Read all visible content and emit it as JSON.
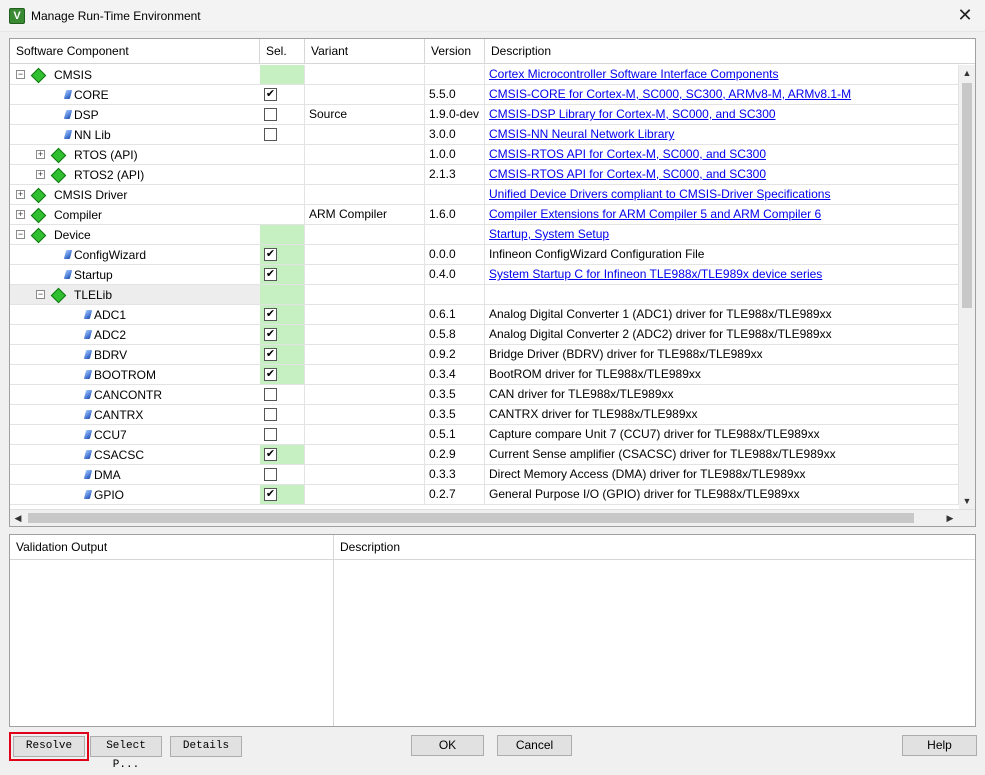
{
  "window": {
    "title": "Manage Run-Time Environment",
    "app_icon": "V"
  },
  "columns": {
    "component": "Software Component",
    "sel": "Sel.",
    "variant": "Variant",
    "version": "Version",
    "description": "Description"
  },
  "rows": [
    {
      "name": "CMSIS",
      "level": 0,
      "expander": "minus",
      "icon": "diamond-icon",
      "sel_green": true,
      "checked": null,
      "variant": "",
      "version": "",
      "desc": "Cortex Microcontroller Software Interface Components",
      "link": true
    },
    {
      "name": "CORE",
      "level": 1,
      "expander": "",
      "icon": "gem-icon",
      "sel_green": false,
      "checked": true,
      "variant": "",
      "version": "5.5.0",
      "desc": "CMSIS-CORE for Cortex-M, SC000, SC300, ARMv8-M, ARMv8.1-M",
      "link": true
    },
    {
      "name": "DSP",
      "level": 1,
      "expander": "",
      "icon": "gem-icon",
      "sel_green": false,
      "checked": false,
      "variant": "Source",
      "version": "1.9.0-dev",
      "desc": "CMSIS-DSP Library for Cortex-M, SC000, and SC300",
      "link": true
    },
    {
      "name": "NN Lib",
      "level": 1,
      "expander": "",
      "icon": "gem-icon",
      "sel_green": false,
      "checked": false,
      "variant": "",
      "version": "3.0.0",
      "desc": "CMSIS-NN Neural Network Library",
      "link": true
    },
    {
      "name": "RTOS (API)",
      "level": 1,
      "expander": "plus",
      "icon": "diamond-icon",
      "sel_green": false,
      "checked": null,
      "variant": "",
      "version": "1.0.0",
      "desc": "CMSIS-RTOS API for Cortex-M, SC000, and SC300",
      "link": true
    },
    {
      "name": "RTOS2 (API)",
      "level": 1,
      "expander": "plus",
      "icon": "diamond-icon",
      "sel_green": false,
      "checked": null,
      "variant": "",
      "version": "2.1.3",
      "desc": "CMSIS-RTOS API for Cortex-M, SC000, and SC300",
      "link": true
    },
    {
      "name": "CMSIS Driver",
      "level": 0,
      "expander": "plus",
      "icon": "diamond-icon",
      "sel_green": false,
      "checked": null,
      "variant": "",
      "version": "",
      "desc": "Unified Device Drivers compliant to CMSIS-Driver Specifications",
      "link": true
    },
    {
      "name": "Compiler",
      "level": 0,
      "expander": "plus",
      "icon": "diamond-icon",
      "sel_green": false,
      "checked": null,
      "variant": "ARM Compiler",
      "version": "1.6.0",
      "desc": "Compiler Extensions for ARM Compiler 5 and ARM Compiler 6",
      "link": true
    },
    {
      "name": "Device",
      "level": 0,
      "expander": "minus",
      "icon": "diamond-icon",
      "sel_green": true,
      "checked": null,
      "variant": "",
      "version": "",
      "desc": "Startup, System Setup",
      "link": true
    },
    {
      "name": "ConfigWizard",
      "level": 1,
      "expander": "",
      "icon": "gem-icon",
      "sel_green": true,
      "checked": true,
      "variant": "",
      "version": "0.0.0",
      "desc": "Infineon ConfigWizard Configuration File",
      "link": false
    },
    {
      "name": "Startup",
      "level": 1,
      "expander": "",
      "icon": "gem-icon",
      "sel_green": true,
      "checked": true,
      "variant": "",
      "version": "0.4.0",
      "desc": "System Startup C for Infineon TLE988x/TLE989x device series",
      "link": true
    },
    {
      "name": "TLELib",
      "level": 1,
      "expander": "minus",
      "icon": "diamond-icon",
      "sel_green": true,
      "checked": null,
      "variant": "",
      "version": "",
      "desc": "",
      "link": false,
      "highlight": true
    },
    {
      "name": "ADC1",
      "level": 2,
      "expander": "",
      "icon": "gem-icon",
      "sel_green": true,
      "checked": true,
      "variant": "",
      "version": "0.6.1",
      "desc": "Analog Digital Converter 1 (ADC1) driver for TLE988x/TLE989xx",
      "link": false
    },
    {
      "name": "ADC2",
      "level": 2,
      "expander": "",
      "icon": "gem-icon",
      "sel_green": true,
      "checked": true,
      "variant": "",
      "version": "0.5.8",
      "desc": "Analog Digital Converter 2 (ADC2) driver for TLE988x/TLE989xx",
      "link": false
    },
    {
      "name": "BDRV",
      "level": 2,
      "expander": "",
      "icon": "gem-icon",
      "sel_green": true,
      "checked": true,
      "variant": "",
      "version": "0.9.2",
      "desc": "Bridge Driver (BDRV) driver for TLE988x/TLE989xx",
      "link": false
    },
    {
      "name": "BOOTROM",
      "level": 2,
      "expander": "",
      "icon": "gem-icon",
      "sel_green": true,
      "checked": true,
      "variant": "",
      "version": "0.3.4",
      "desc": "BootROM driver for TLE988x/TLE989xx",
      "link": false
    },
    {
      "name": "CANCONTR",
      "level": 2,
      "expander": "",
      "icon": "gem-icon",
      "sel_green": false,
      "checked": false,
      "variant": "",
      "version": "0.3.5",
      "desc": "CAN driver for TLE988x/TLE989xx",
      "link": false
    },
    {
      "name": "CANTRX",
      "level": 2,
      "expander": "",
      "icon": "gem-icon",
      "sel_green": false,
      "checked": false,
      "variant": "",
      "version": "0.3.5",
      "desc": "CANTRX driver for TLE988x/TLE989xx",
      "link": false
    },
    {
      "name": "CCU7",
      "level": 2,
      "expander": "",
      "icon": "gem-icon",
      "sel_green": false,
      "checked": false,
      "variant": "",
      "version": "0.5.1",
      "desc": "Capture compare Unit 7 (CCU7) driver for TLE988x/TLE989xx",
      "link": false
    },
    {
      "name": "CSACSC",
      "level": 2,
      "expander": "",
      "icon": "gem-icon",
      "sel_green": true,
      "checked": true,
      "variant": "",
      "version": "0.2.9",
      "desc": "Current Sense amplifier (CSACSC) driver for TLE988x/TLE989xx",
      "link": false
    },
    {
      "name": "DMA",
      "level": 2,
      "expander": "",
      "icon": "gem-icon",
      "sel_green": false,
      "checked": false,
      "variant": "",
      "version": "0.3.3",
      "desc": "Direct Memory Access (DMA) driver for TLE988x/TLE989xx",
      "link": false
    },
    {
      "name": "GPIO",
      "level": 2,
      "expander": "",
      "icon": "gem-icon",
      "sel_green": true,
      "checked": true,
      "variant": "",
      "version": "0.2.7",
      "desc": "General Purpose I/O (GPIO) driver for TLE988x/TLE989xx",
      "link": false
    }
  ],
  "validation": {
    "output_header": "Validation Output",
    "description_header": "Description"
  },
  "buttons": {
    "resolve": "Resolve",
    "select_packs": "Select P...",
    "details": "Details",
    "ok": "OK",
    "cancel": "Cancel",
    "help": "Help"
  },
  "colors": {
    "selected_green": "#c6efc2",
    "link_blue": "#0000ee",
    "resolve_highlight": "#e0001a"
  }
}
